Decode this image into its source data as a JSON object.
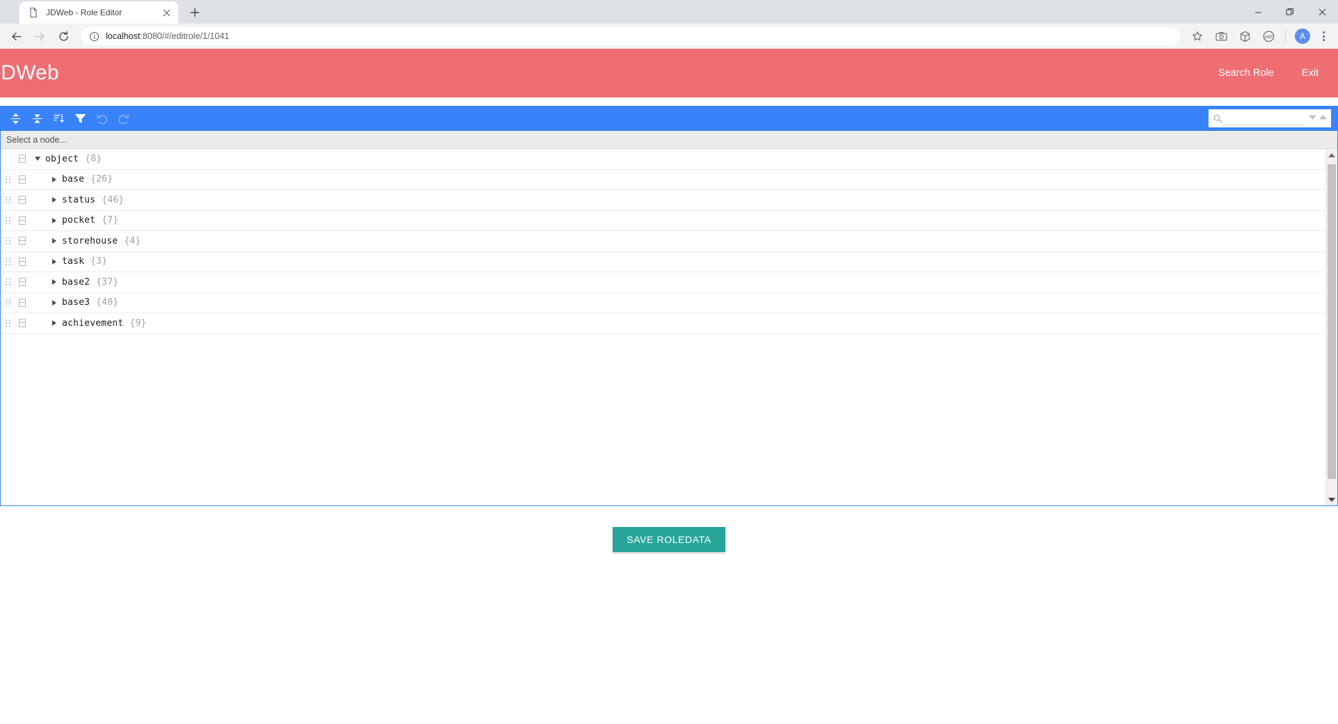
{
  "browser": {
    "tab": {
      "title": "JDWeb - Role Editor",
      "favicon_icon": "page-icon",
      "close_icon": "close-icon"
    },
    "new_tab_label": "+",
    "window_controls": {
      "minimize": "minimize-icon",
      "maximize": "restore-icon",
      "close": "close-icon"
    },
    "nav": {
      "back_icon": "back-arrow-icon",
      "forward_icon": "forward-arrow-icon",
      "reload_icon": "reload-icon"
    },
    "omnibox": {
      "info_icon": "info-circle-icon",
      "url_host": "localhost",
      "url_path": ":8080/#/editrole/1/1041",
      "url_full": "localhost:8080/#/editrole/1/1041"
    },
    "toolbar_icons": [
      "bookmark-star-icon",
      "camera-icon",
      "cube-extension-icon",
      "adblock-plus-icon"
    ],
    "profile_initial": "A",
    "menu_icon": "kebab-menu-icon"
  },
  "app": {
    "brand": "JDWeb",
    "brand_color": "#ee6e73",
    "nav": [
      {
        "label": "Search Role",
        "name": "search-role-link"
      },
      {
        "label": "Exit",
        "name": "exit-link"
      }
    ]
  },
  "editor": {
    "accent_color": "#3883fa",
    "menu_buttons": [
      {
        "name": "expand-all-button",
        "icon": "expand-all-icon",
        "enabled": true
      },
      {
        "name": "collapse-all-button",
        "icon": "collapse-all-icon",
        "enabled": true
      },
      {
        "name": "sort-button",
        "icon": "sort-icon",
        "enabled": true
      },
      {
        "name": "filter-button",
        "icon": "filter-funnel-icon",
        "enabled": true
      },
      {
        "name": "undo-button",
        "icon": "undo-icon",
        "enabled": false
      },
      {
        "name": "redo-button",
        "icon": "redo-icon",
        "enabled": false
      }
    ],
    "search": {
      "value": "",
      "placeholder": "",
      "icon": "search-icon",
      "next_icon": "chevron-down-icon",
      "prev_icon": "chevron-up-icon"
    },
    "breadcrumb": "Select a node...",
    "tree": {
      "root": {
        "label": "object",
        "count": "{8}",
        "expanded": true
      },
      "children": [
        {
          "label": "base",
          "count": "{26}"
        },
        {
          "label": "status",
          "count": "{46}"
        },
        {
          "label": "pocket",
          "count": "{7}"
        },
        {
          "label": "storehouse",
          "count": "{4}"
        },
        {
          "label": "task",
          "count": "{3}"
        },
        {
          "label": "base2",
          "count": "{37}"
        },
        {
          "label": "base3",
          "count": "{40}"
        },
        {
          "label": "achievement",
          "count": "{9}"
        }
      ]
    }
  },
  "actions": {
    "save_label": "SAVE ROLEDATA",
    "save_color": "#26a69a"
  }
}
